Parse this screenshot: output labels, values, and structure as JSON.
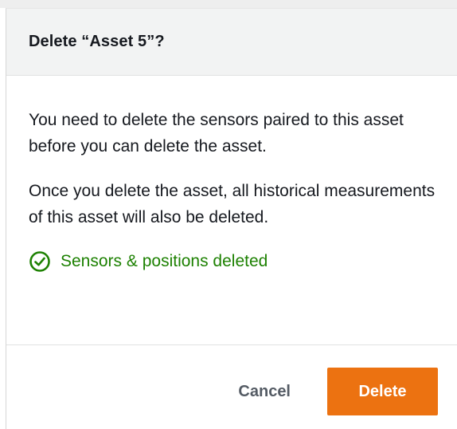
{
  "dialog": {
    "title": "Delete “Asset 5”?",
    "paragraphs": [
      "You need to delete the sensors paired to this asset before you can delete the asset.",
      "Once you delete the asset, all historical measurements of this asset will also be deleted."
    ],
    "status": {
      "icon": "check-circle-icon",
      "text": "Sensors & positions deleted",
      "color": "#1d8102"
    },
    "buttons": {
      "cancel_label": "Cancel",
      "delete_label": "Delete"
    }
  },
  "colors": {
    "header_bg": "#f2f3f3",
    "primary_button": "#ec7211",
    "text": "#16191f",
    "success": "#1d8102"
  }
}
